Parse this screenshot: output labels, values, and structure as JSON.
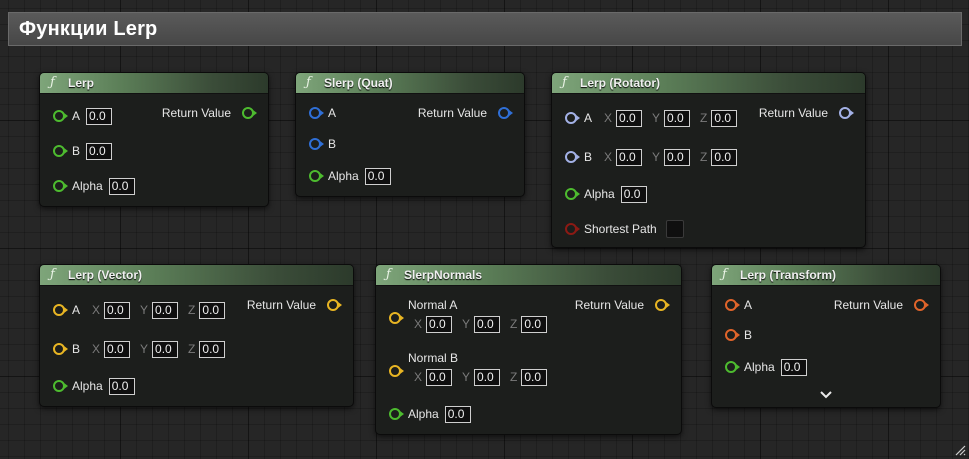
{
  "comment_title": "Функции Lerp",
  "nodes": {
    "lerp": {
      "title": "Lerp",
      "return_label": "Return Value",
      "pin_a": "A",
      "pin_b": "B",
      "pin_alpha": "Alpha",
      "a": "0.0",
      "b": "0.0",
      "alpha": "0.0"
    },
    "slerp_quat": {
      "title": "Slerp (Quat)",
      "return_label": "Return Value",
      "pin_a": "A",
      "pin_b": "B",
      "pin_alpha": "Alpha",
      "alpha": "0.0"
    },
    "lerp_rotator": {
      "title": "Lerp (Rotator)",
      "return_label": "Return Value",
      "pin_a": "A",
      "pin_b": "B",
      "pin_alpha": "Alpha",
      "pin_shortest": "Shortest Path",
      "axis_x": "X",
      "axis_y": "Y",
      "axis_z": "Z",
      "a": {
        "x": "0.0",
        "y": "0.0",
        "z": "0.0"
      },
      "b": {
        "x": "0.0",
        "y": "0.0",
        "z": "0.0"
      },
      "alpha": "0.0",
      "shortest_path": false
    },
    "lerp_vector": {
      "title": "Lerp (Vector)",
      "return_label": "Return Value",
      "pin_a": "A",
      "pin_b": "B",
      "pin_alpha": "Alpha",
      "axis_x": "X",
      "axis_y": "Y",
      "axis_z": "Z",
      "a": {
        "x": "0.0",
        "y": "0.0",
        "z": "0.0"
      },
      "b": {
        "x": "0.0",
        "y": "0.0",
        "z": "0.0"
      },
      "alpha": "0.0"
    },
    "slerp_normals": {
      "title": "SlerpNormals",
      "return_label": "Return Value",
      "pin_a": "Normal A",
      "pin_b": "Normal B",
      "pin_alpha": "Alpha",
      "axis_x": "X",
      "axis_y": "Y",
      "axis_z": "Z",
      "a": {
        "x": "0.0",
        "y": "0.0",
        "z": "0.0"
      },
      "b": {
        "x": "0.0",
        "y": "0.0",
        "z": "0.0"
      },
      "alpha": "0.0"
    },
    "lerp_transform": {
      "title": "Lerp (Transform)",
      "return_label": "Return Value",
      "pin_a": "A",
      "pin_b": "B",
      "pin_alpha": "Alpha",
      "alpha": "0.0"
    }
  },
  "colors": {
    "float_pin": "#4dbb2f",
    "quat_pin": "#2f6fd6",
    "rotator_pin": "#a3b1e6",
    "bool_pin": "#8c1a14",
    "vector_pin": "#e8b523",
    "transform_pin": "#e0642a",
    "header_green": "#5c7f58"
  },
  "icons": {
    "function": "function-icon",
    "expand": "chevron-down-icon",
    "resize": "resize-grip-icon"
  }
}
